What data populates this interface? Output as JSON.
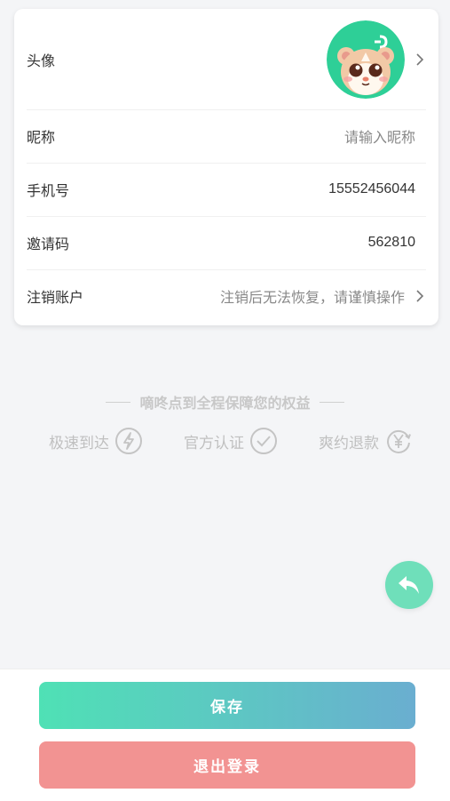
{
  "profile": {
    "avatar_label": "头像",
    "nickname_label": "昵称",
    "nickname_placeholder": "请输入昵称",
    "phone_label": "手机号",
    "phone_value": "15552456044",
    "invite_label": "邀请码",
    "invite_value": "562810",
    "cancel_label": "注销账户",
    "cancel_hint": "注销后无法恢复，请谨慎操作"
  },
  "guarantee": {
    "title": "嘀咚点到全程保障您的权益",
    "features": [
      {
        "label": "极速到达",
        "icon": "lightning-icon"
      },
      {
        "label": "官方认证",
        "icon": "check-circle-icon"
      },
      {
        "label": "爽约退款",
        "icon": "yen-refund-icon"
      }
    ]
  },
  "fab": {
    "icon": "back-arrow-icon"
  },
  "buttons": {
    "save": "保存",
    "logout": "退出登录"
  },
  "colors": {
    "accent_green": "#4fe1b5",
    "accent_blue": "#6aaed0",
    "logout_red": "#f29392",
    "fab_green": "#6fdfba"
  }
}
